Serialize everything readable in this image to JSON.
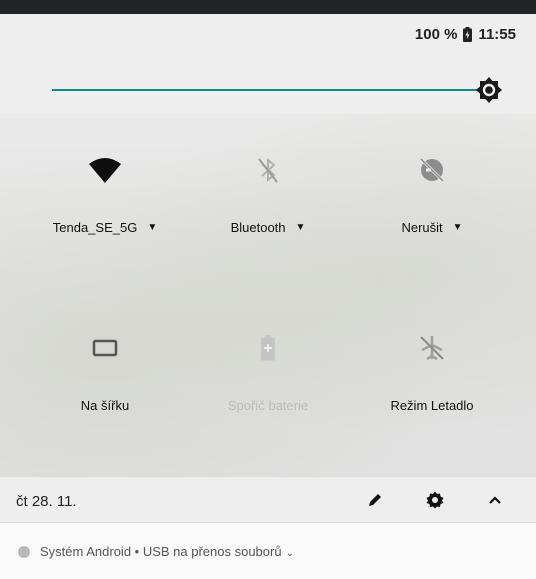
{
  "status_bar": {
    "battery_percent": "100 %",
    "time": "11:55"
  },
  "brightness": {
    "level_fraction": 0.997
  },
  "tiles": [
    {
      "label": "Tenda_SE_5G",
      "icon": "wifi-icon",
      "has_dropdown": true,
      "enabled": true
    },
    {
      "label": "Bluetooth",
      "icon": "bluetooth-off-icon",
      "has_dropdown": true,
      "enabled": true
    },
    {
      "label": "Nerušit",
      "icon": "do-not-disturb-off-icon",
      "has_dropdown": true,
      "enabled": true
    },
    {
      "label": "Na šířku",
      "icon": "screen-rotation-icon",
      "has_dropdown": false,
      "enabled": true
    },
    {
      "label": "Spořič baterie",
      "icon": "battery-saver-icon",
      "has_dropdown": false,
      "enabled": false
    },
    {
      "label": "Režim Letadlo",
      "icon": "airplane-mode-off-icon",
      "has_dropdown": false,
      "enabled": true
    }
  ],
  "footer": {
    "date": "čt 28. 11.",
    "edit_icon": "pencil-icon",
    "settings_icon": "gear-icon",
    "collapse_icon": "chevron-up-icon"
  },
  "notification": {
    "text": "Systém Android • USB na přenos souborů"
  },
  "colors": {
    "accent": "#0f8a87",
    "panel": "#eeeeee"
  }
}
